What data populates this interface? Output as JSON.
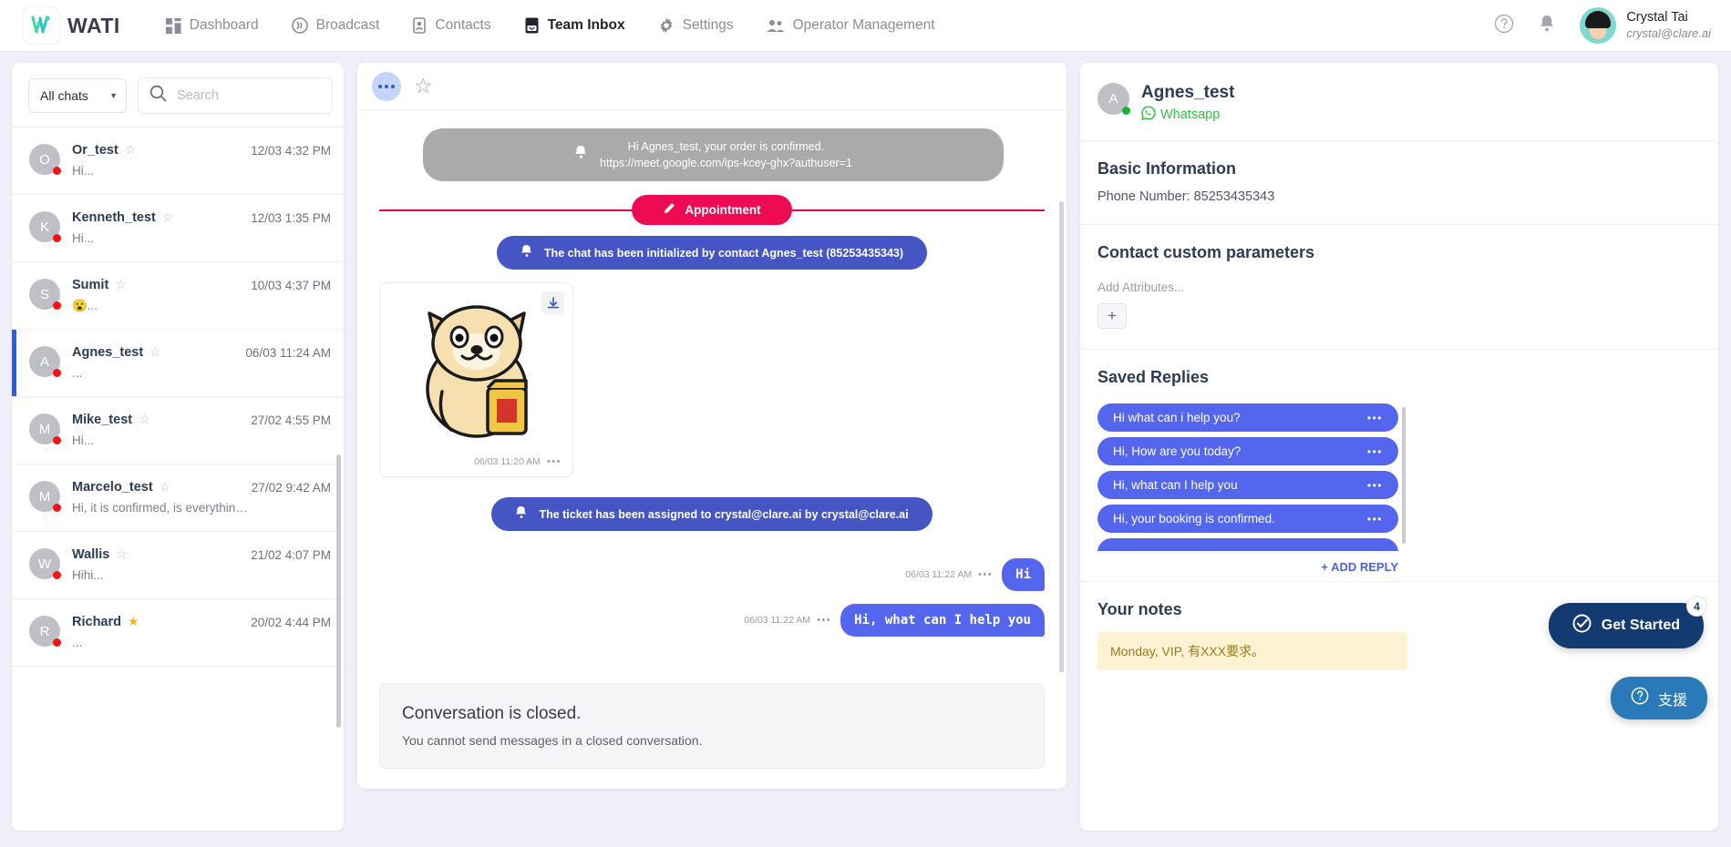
{
  "header": {
    "brand": "WATI",
    "brand_logo_icon": "wati-logo-icon",
    "nav": [
      {
        "label": "Dashboard",
        "icon": "dashboard-icon",
        "active": false
      },
      {
        "label": "Broadcast",
        "icon": "broadcast-icon",
        "active": false
      },
      {
        "label": "Contacts",
        "icon": "contacts-icon",
        "active": false
      },
      {
        "label": "Team Inbox",
        "icon": "team-inbox-icon",
        "active": true
      },
      {
        "label": "Settings",
        "icon": "gear-icon",
        "active": false
      },
      {
        "label": "Operator Management",
        "icon": "operators-icon",
        "active": false
      }
    ],
    "help_icon": "help-circle-icon",
    "bell_icon": "bell-icon",
    "user": {
      "name": "Crystal Tai",
      "email": "crystal@clare.ai",
      "avatar_icon": "avatar"
    }
  },
  "chatlist": {
    "filter_label": "All chats",
    "filter_caret_icon": "chevron-down-icon",
    "search_placeholder": "Search",
    "search_value": "",
    "search_icon": "search-icon",
    "rows": [
      {
        "initial": "O",
        "name": "Or_test",
        "preview": "Hi...",
        "time": "12/03 4:32 PM",
        "starred": false,
        "selected": false
      },
      {
        "initial": "K",
        "name": "Kenneth_test",
        "preview": "Hi...",
        "time": "12/03 1:35 PM",
        "starred": false,
        "selected": false
      },
      {
        "initial": "S",
        "name": "Sumit",
        "preview": "😮...",
        "time": "10/03 4:37 PM",
        "starred": false,
        "selected": false
      },
      {
        "initial": "A",
        "name": "Agnes_test",
        "preview": "...",
        "time": "06/03 11:24 AM",
        "starred": false,
        "selected": true
      },
      {
        "initial": "M",
        "name": "Mike_test",
        "preview": "Hi...",
        "time": "27/02 4:55 PM",
        "starred": false,
        "selected": false
      },
      {
        "initial": "M",
        "name": "Marcelo_test",
        "preview": "Hi, it is confirmed, is everything ok? ...",
        "time": "27/02 9:42 AM",
        "starred": false,
        "selected": false
      },
      {
        "initial": "W",
        "name": "Wallis",
        "preview": "Hihi...",
        "time": "21/02 4:07 PM",
        "starred": false,
        "selected": false
      },
      {
        "initial": "R",
        "name": "Richard",
        "preview": "...",
        "time": "20/02 4:44 PM",
        "starred": true,
        "selected": false
      }
    ]
  },
  "conversation": {
    "toolbar": {
      "more_icon": "more-dots-icon",
      "star_icon": "star-outline-icon"
    },
    "system_gray": {
      "icon": "bell-icon",
      "line1": "Hi Agnes_test, your order is confirmed.",
      "line2": "https://meet.google.com/ips-kcey-ghx?authuser=1"
    },
    "divider": {
      "label": "Appointment",
      "icon": "pencil-icon",
      "color": "#ef0a54"
    },
    "system_blue_1": {
      "icon": "bell-icon",
      "text": "The chat has been initialized by contact Agnes_test (85253435343)"
    },
    "sticker": {
      "download_icon": "download-icon",
      "time": "06/03 11:20 AM",
      "more_icon": "more-dots-icon",
      "art": "dog-sticker"
    },
    "system_blue_2": {
      "icon": "bell-icon",
      "text": "The ticket has been assigned to crystal@clare.ai by crystal@clare.ai"
    },
    "messages": [
      {
        "text": "Hi",
        "time": "06/03 11:22 AM",
        "direction": "out"
      },
      {
        "text": "Hi, what can I help you",
        "time": "06/03 11:22 AM",
        "direction": "out"
      }
    ],
    "closed": {
      "title": "Conversation is closed.",
      "subtitle": "You cannot send messages in a closed conversation."
    }
  },
  "rightpanel": {
    "contact": {
      "initial": "A",
      "name": "Agnes_test",
      "channel": "Whatsapp",
      "channel_icon": "whatsapp-icon"
    },
    "basic_info": {
      "heading": "Basic Information",
      "phone_label": "Phone Number: 85253435343"
    },
    "custom_params": {
      "heading": "Contact custom parameters",
      "add_attributes": "Add Attributes...",
      "add_icon": "plus-icon"
    },
    "saved_replies": {
      "heading": "Saved Replies",
      "items": [
        {
          "text": "Hi what can i help you?",
          "more_icon": "more-dots-icon"
        },
        {
          "text": "Hi, How are you today?",
          "more_icon": "more-dots-icon"
        },
        {
          "text": "Hi, what can I help you",
          "more_icon": "more-dots-icon"
        },
        {
          "text": "Hi, your booking is confirmed.",
          "more_icon": "more-dots-icon"
        }
      ],
      "add_reply_label": "+ ADD REPLY"
    },
    "notes": {
      "heading": "Your notes",
      "text": "Monday, VIP, 有XXX要求。"
    }
  },
  "widgets": {
    "get_started": {
      "label": "Get Started",
      "badge": "4",
      "icon": "check-circle-icon"
    },
    "support": {
      "label": "支援",
      "icon": "help-circle-icon"
    }
  }
}
